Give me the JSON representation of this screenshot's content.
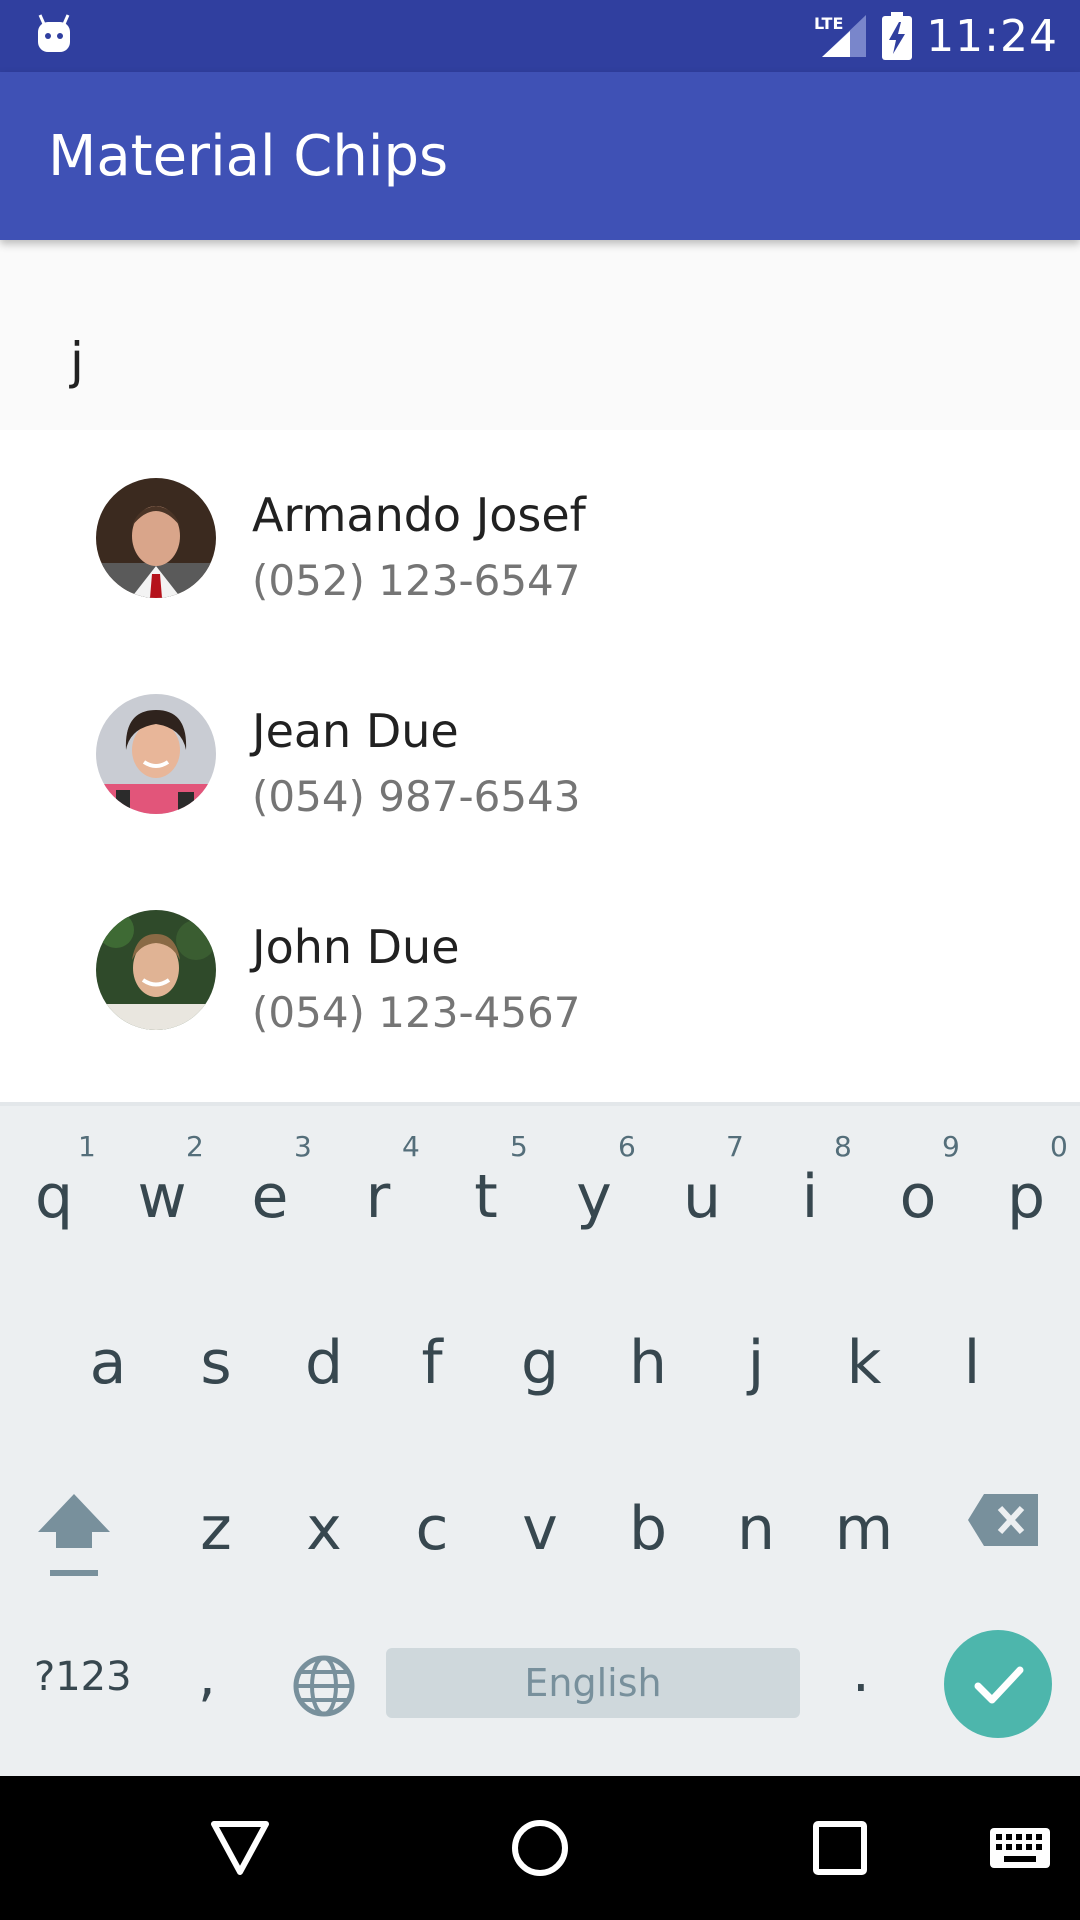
{
  "status_bar": {
    "time": "11:24",
    "network_label": "LTE",
    "icons": [
      "android-debug-icon",
      "lte-signal-icon",
      "battery-charging-icon"
    ]
  },
  "app_bar": {
    "title": "Material Chips"
  },
  "chips_input": {
    "value": "j"
  },
  "contacts": [
    {
      "name": "Armando Josef",
      "phone": "(052) 123-6547",
      "avatar_icon": "avatar-photo"
    },
    {
      "name": "Jean Due",
      "phone": "(054) 987-6543",
      "avatar_icon": "avatar-photo"
    },
    {
      "name": "John Due",
      "phone": "(054) 123-4567",
      "avatar_icon": "avatar-photo"
    }
  ],
  "keyboard": {
    "row1": [
      "q",
      "w",
      "e",
      "r",
      "t",
      "y",
      "u",
      "i",
      "o",
      "p"
    ],
    "row1_hints": [
      "1",
      "2",
      "3",
      "4",
      "5",
      "6",
      "7",
      "8",
      "9",
      "0"
    ],
    "row2": [
      "a",
      "s",
      "d",
      "f",
      "g",
      "h",
      "j",
      "k",
      "l"
    ],
    "row3": [
      "z",
      "x",
      "c",
      "v",
      "b",
      "n",
      "m"
    ],
    "symbols_label": "?123",
    "comma_label": ",",
    "period_label": ".",
    "space_label": "English",
    "accent_color": "#4db6ac"
  },
  "nav_bar": {
    "icons": [
      "back-icon",
      "home-icon",
      "recents-icon",
      "keyboard-switch-icon"
    ]
  }
}
